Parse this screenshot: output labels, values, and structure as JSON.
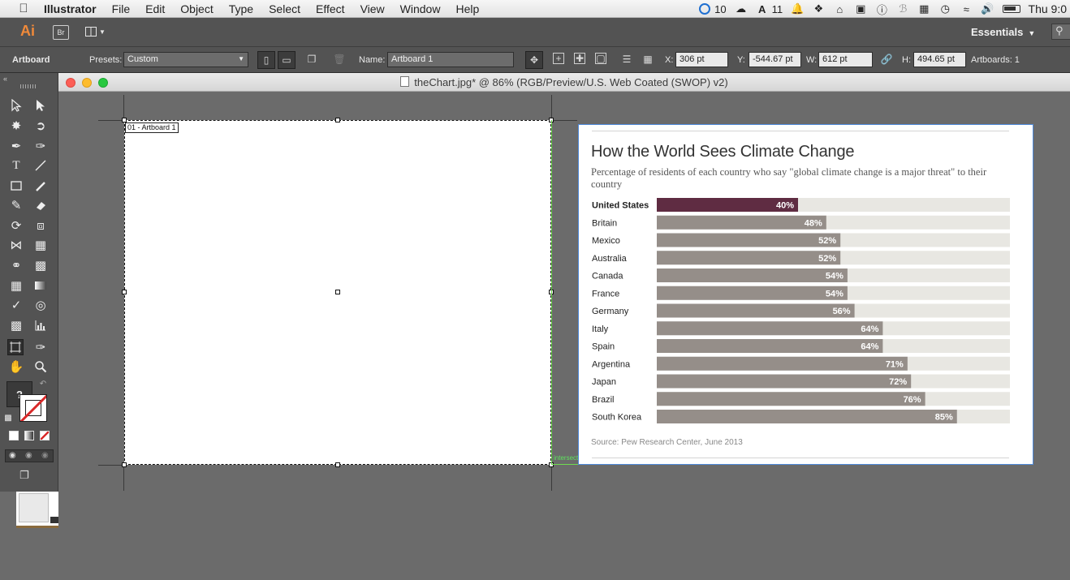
{
  "menubar": {
    "app_name": "Illustrator",
    "menus": [
      "File",
      "Edit",
      "Object",
      "Type",
      "Select",
      "Effect",
      "View",
      "Window",
      "Help"
    ],
    "status": {
      "cc_count": "10",
      "adobe_count": "11",
      "clock": "Thu 9:0"
    }
  },
  "appbar": {
    "logo": "Ai",
    "bridge": "Br",
    "workspace": "Essentials"
  },
  "controlbar": {
    "mode_label": "Artboard",
    "presets_label": "Presets:",
    "presets_value": "Custom",
    "name_label": "Name:",
    "name_value": "Artboard 1",
    "x_label": "X:",
    "x_value": "306 pt",
    "y_label": "Y:",
    "y_value": "-544.67 pt",
    "w_label": "W:",
    "w_value": "612 pt",
    "h_label": "H:",
    "h_value": "494.65 pt",
    "artboards_label": "Artboards: 1"
  },
  "tools": {
    "fill_unknown": "?"
  },
  "document": {
    "title": "theChart.jpg* @ 86% (RGB/Preview/U.S. Web Coated (SWOP) v2)",
    "artboard_label": "01 - Artboard 1",
    "intersect_label": "intersect"
  },
  "chart_data": {
    "type": "bar",
    "orientation": "horizontal",
    "title": "How the World Sees Climate Change",
    "subtitle": "Percentage of residents of each country who say \"global climate change is a major threat\" to their country",
    "categories": [
      "United States",
      "Britain",
      "Mexico",
      "Australia",
      "Canada",
      "France",
      "Germany",
      "Italy",
      "Spain",
      "Argentina",
      "Japan",
      "Brazil",
      "South Korea"
    ],
    "values": [
      40,
      48,
      52,
      52,
      54,
      54,
      56,
      64,
      64,
      71,
      72,
      76,
      85
    ],
    "value_labels": [
      "40%",
      "48%",
      "52%",
      "52%",
      "54%",
      "54%",
      "56%",
      "64%",
      "64%",
      "71%",
      "72%",
      "76%",
      "85%"
    ],
    "xlim": [
      0,
      100
    ],
    "highlight": "United States",
    "colors": {
      "highlight": "#5f2c42",
      "bar": "#958e89",
      "track": "#e8e7e2"
    },
    "source": "Source: Pew Research Center, June 2013"
  }
}
